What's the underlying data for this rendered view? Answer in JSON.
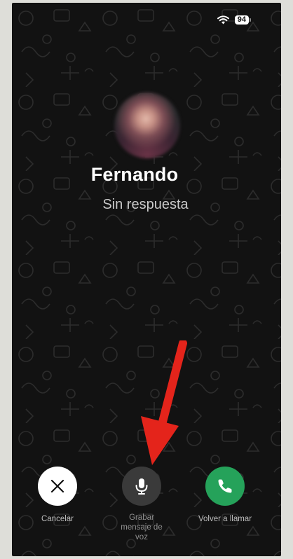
{
  "status": {
    "wifi_icon": "wifi-icon",
    "battery_level": "94"
  },
  "call": {
    "contact_name": "Fernando",
    "status_text": "Sin respuesta"
  },
  "actions": {
    "cancel": {
      "icon": "close-icon",
      "label": "Cancelar"
    },
    "record": {
      "icon": "microphone-icon",
      "label": "Grabar mensaje de voz"
    },
    "recall": {
      "icon": "phone-icon",
      "label": "Volver a llamar"
    }
  },
  "colors": {
    "background": "#121212",
    "accept_green": "#25a25a",
    "annotation_arrow": "#e4241b"
  }
}
